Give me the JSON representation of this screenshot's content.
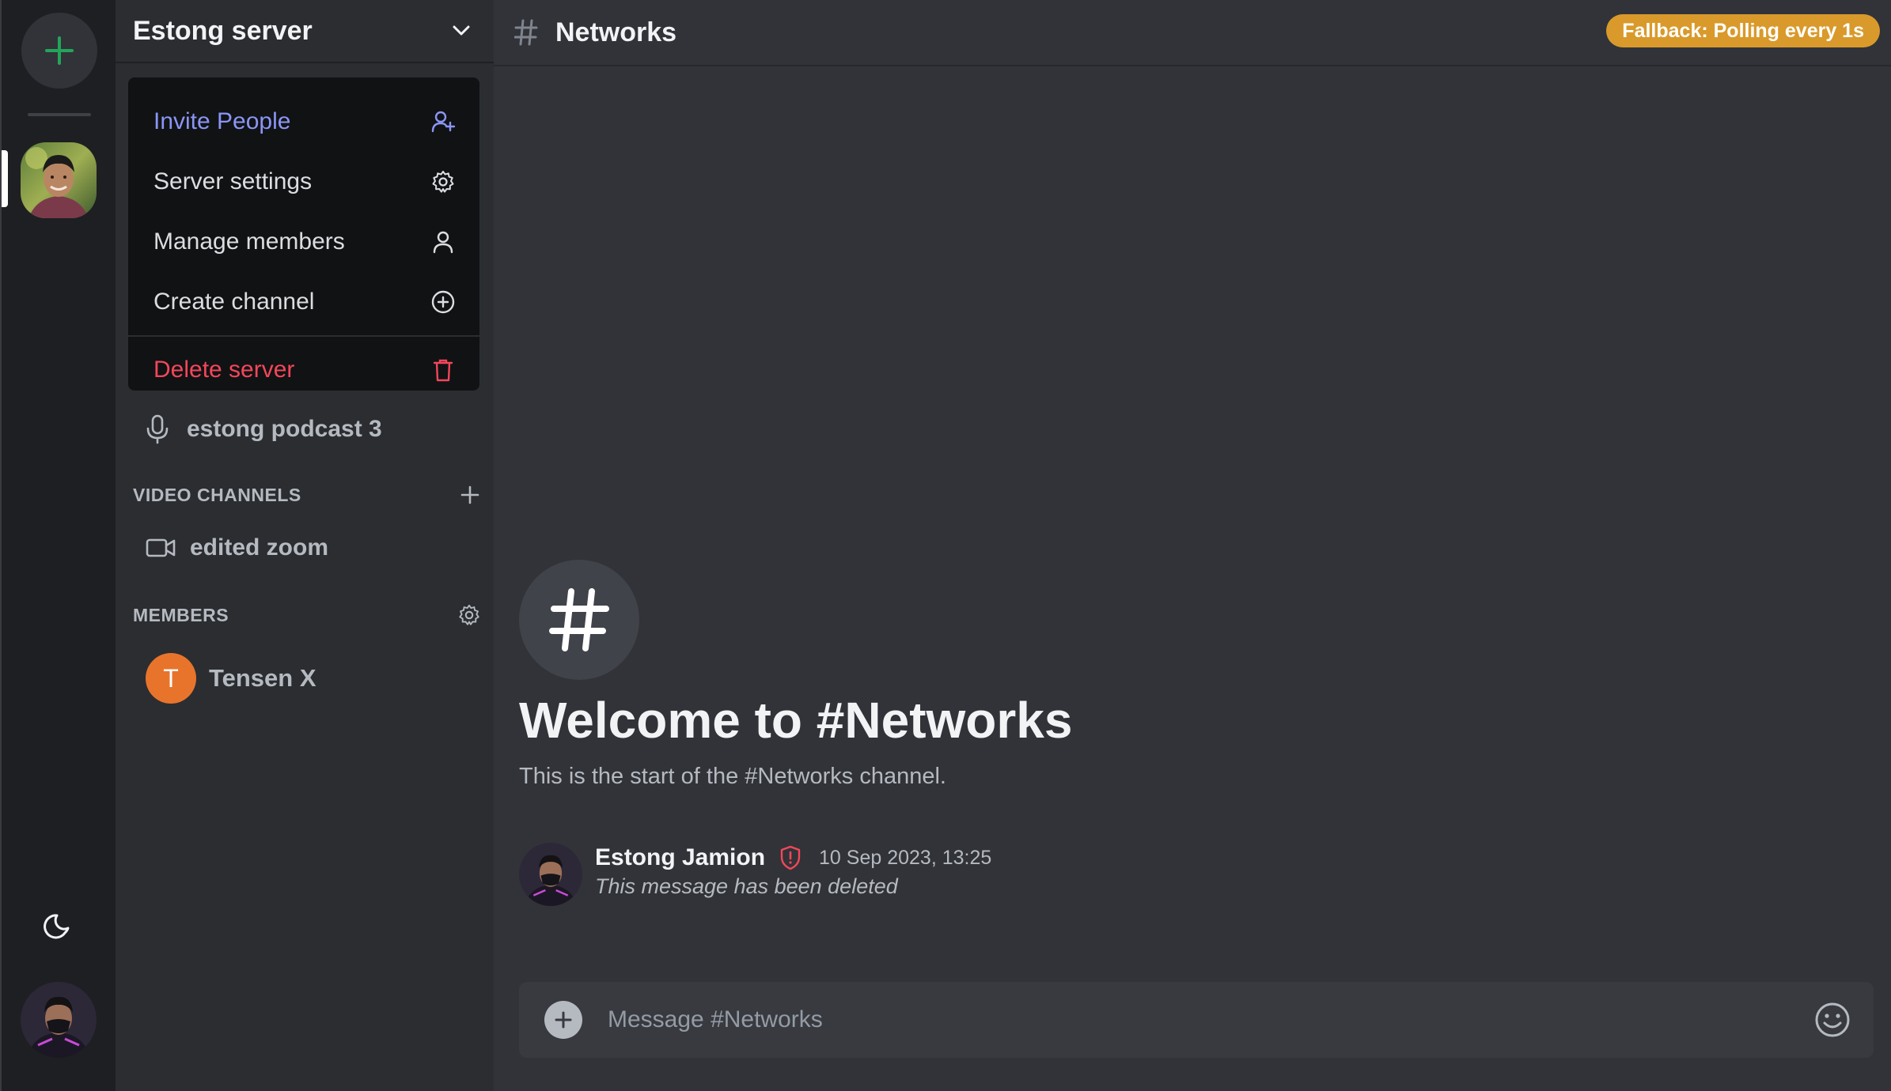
{
  "server": {
    "name": "Estong server"
  },
  "menu": {
    "items": [
      {
        "label": "Invite People",
        "icon": "user-plus-icon"
      },
      {
        "label": "Server settings",
        "icon": "gear-icon"
      },
      {
        "label": "Manage members",
        "icon": "user-icon"
      },
      {
        "label": "Create channel",
        "icon": "plus-circle-icon"
      }
    ],
    "danger": {
      "label": "Delete server",
      "icon": "trash-icon"
    }
  },
  "channels": {
    "voice": [
      {
        "name": "estong podcast 3",
        "icon": "mic-icon"
      }
    ],
    "video_title": "VIDEO CHANNELS",
    "video": [
      {
        "name": "edited zoom",
        "icon": "video-icon"
      }
    ],
    "members_title": "MEMBERS",
    "members": [
      {
        "initial": "T",
        "name": "Tensen X"
      }
    ]
  },
  "header": {
    "channel": "Networks",
    "badge": "Fallback: Polling every 1s"
  },
  "welcome": {
    "title": "Welcome to #Networks",
    "subtitle": "This is the start of the #Networks channel."
  },
  "messages": [
    {
      "author": "Estong Jamion",
      "time": "10 Sep 2023, 13:25",
      "body": "This message has been deleted"
    }
  ],
  "composer": {
    "placeholder": "Message #Networks"
  },
  "colors": {
    "accent": "#8b95f5",
    "danger": "#f2475a",
    "badge": "#d99a2b",
    "online_add": "#23a55a",
    "member_avatar": "#e8742c"
  }
}
